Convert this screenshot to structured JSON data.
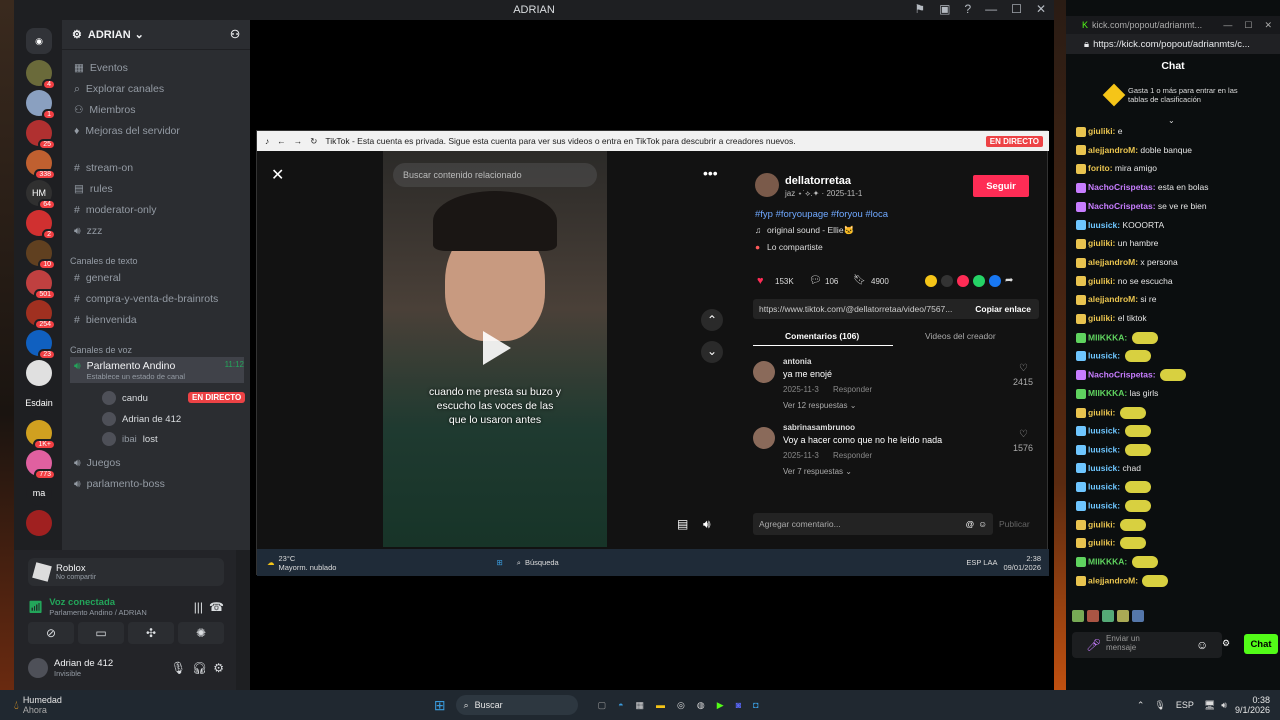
{
  "discord": {
    "title": "ADRIAN",
    "server_name": "ADRIAN",
    "guilds": [
      {
        "badge": "4",
        "label": ""
      },
      {
        "badge": "1",
        "label": ""
      },
      {
        "badge": "25",
        "label": ""
      },
      {
        "badge": "338",
        "label": ""
      },
      {
        "badge": "64",
        "label": "HM"
      },
      {
        "badge": "2",
        "label": ""
      },
      {
        "badge": "10",
        "label": ""
      },
      {
        "badge": "501",
        "label": ""
      },
      {
        "badge": "254",
        "label": ""
      },
      {
        "badge": "23",
        "label": ""
      },
      {
        "badge": "",
        "label": ""
      },
      {
        "badge": "",
        "label": "Esdain"
      },
      {
        "badge": "1K+",
        "label": ""
      },
      {
        "badge": "773",
        "label": ""
      },
      {
        "badge": "",
        "label": "ma"
      },
      {
        "badge": "",
        "label": ""
      }
    ],
    "menu": [
      "Eventos",
      "Explorar canales",
      "Miembros",
      "Mejoras del servidor"
    ],
    "top_channels": [
      "stream-on",
      "rules",
      "moderator-only",
      "zzz"
    ],
    "text_category": "Canales de texto",
    "text_channels": [
      "general",
      "compra-y-venta-de-brainrots",
      "bienvenida"
    ],
    "voice_category": "Canales de voz",
    "voice_channel": {
      "name": "Parlamento Andino",
      "timer": "11:12",
      "status": "Establece un estado de canal"
    },
    "voice_users": [
      {
        "name": "candu",
        "tag": "EN DIRECTO"
      },
      {
        "name": "Adrian de 412",
        "tag": ""
      },
      {
        "name": "ibai",
        "tag": "lost"
      }
    ],
    "other_channels": [
      "Juegos",
      "parlamento-boss"
    ],
    "activity": {
      "title": "Roblox",
      "subtitle": "No compartir"
    },
    "voice_connected": {
      "title": "Voz conectada",
      "subtitle": "Parlamento Andino / ADRIAN"
    },
    "user": {
      "name": "Adrian de 412",
      "status": "Invisible"
    }
  },
  "tiktok": {
    "bar_text": "TikTok - Esta cuenta es privada. Sigue esta cuenta para ver sus videos o entra en TikTok para descubrir a creadores nuevos.",
    "live_label": "EN DIRECTO",
    "search_placeholder": "Buscar contenido relacionado",
    "caption_line1": "cuando me presta su buzo y",
    "caption_line2": "escucho las voces de las",
    "caption_line3": "que lo usaron antes",
    "username": "dellatorretaa",
    "handle_date": "jaz ⋆˙⟡.✦ · 2025-11-1",
    "follow": "Seguir",
    "hashtags": "#fyp #foryoupage #foryou #loca",
    "sound": "original sound - Ellie🐱",
    "shared": "Lo compartiste",
    "likes": "153K",
    "comments_count": "106",
    "saves": "4900",
    "link": "https://www.tiktok.com/@dellatorretaa/video/7567...",
    "copy_link": "Copiar enlace",
    "tab_comments": "Comentarios (106)",
    "tab_videos": "Videos del creador",
    "comments": [
      {
        "user": "antonia",
        "text": "ya me enojé",
        "date": "2025-11-3",
        "reply": "Responder",
        "likes": "2415",
        "replies": "Ver 12 respuestas"
      },
      {
        "user": "sabrinasambrunoo",
        "text": "Voy a hacer como que no he leído nada",
        "date": "2025-11-3",
        "reply": "Responder",
        "likes": "1576",
        "replies": "Ver 7 respuestas"
      }
    ],
    "add_comment": "Agregar comentario...",
    "publish": "Publicar",
    "weather_temp": "23°C",
    "weather_desc": "Mayorm. nublado",
    "inner_search": "Búsqueda",
    "inner_lang": "ESP\nLAA",
    "inner_time": "2:38",
    "inner_date": "09/01/2026"
  },
  "kick": {
    "window_title": "kick.com/popout/adrianmt...",
    "url": "https://kick.com/popout/adrianmts/c...",
    "chat_title": "Chat",
    "promo": "Gasta 1 o más para entrar en las tablas de clasificación",
    "messages": [
      {
        "user": "giuliki",
        "text": "e",
        "color": "#e9c44f"
      },
      {
        "user": "alejjandroM",
        "text": "doble banque",
        "color": "#e9c44f"
      },
      {
        "user": "forito",
        "text": "mira amigo",
        "color": "#e9c44f"
      },
      {
        "user": "NachoCrispetas",
        "text": "esta en bolas",
        "color": "#c77dff"
      },
      {
        "user": "NachoCrispetas",
        "text": "se ve re bien",
        "color": "#c77dff"
      },
      {
        "user": "luusick",
        "text": "KOOORTA",
        "color": "#6ec6ff"
      },
      {
        "user": "giuliki",
        "text": "un hambre",
        "color": "#e9c44f"
      },
      {
        "user": "alejjandroM",
        "text": "x persona",
        "color": "#e9c44f"
      },
      {
        "user": "giuliki",
        "text": "no se escucha",
        "color": "#e9c44f"
      },
      {
        "user": "alejjandroM",
        "text": "si re",
        "color": "#e9c44f"
      },
      {
        "user": "giuliki",
        "text": "el tiktok",
        "color": "#e9c44f"
      },
      {
        "user": "MIIKKKA",
        "text": "",
        "color": "#5fd35f"
      },
      {
        "user": "luusick",
        "text": "",
        "color": "#6ec6ff"
      },
      {
        "user": "NachoCrispetas",
        "text": "",
        "color": "#c77dff"
      },
      {
        "user": "MIIKKKA",
        "text": "las girls",
        "color": "#5fd35f"
      },
      {
        "user": "giuliki",
        "text": "",
        "color": "#e9c44f"
      },
      {
        "user": "luusick",
        "text": "",
        "color": "#6ec6ff"
      },
      {
        "user": "luusick",
        "text": "",
        "color": "#6ec6ff"
      },
      {
        "user": "luusick",
        "text": "chad",
        "color": "#6ec6ff"
      },
      {
        "user": "luusick",
        "text": "",
        "color": "#6ec6ff"
      },
      {
        "user": "luusick",
        "text": "",
        "color": "#6ec6ff"
      },
      {
        "user": "giuliki",
        "text": "",
        "color": "#e9c44f"
      },
      {
        "user": "giuliki",
        "text": "",
        "color": "#e9c44f"
      },
      {
        "user": "MIIKKKA",
        "text": "",
        "color": "#5fd35f"
      },
      {
        "user": "alejjandroM",
        "text": "",
        "color": "#e9c44f"
      }
    ],
    "input_placeholder": "Enviar un mensaje",
    "chat_button": "Chat"
  },
  "taskbar": {
    "weather_title": "Humedad",
    "weather_sub": "Ahora",
    "search": "Buscar",
    "lang": "ESP",
    "time": "0:38",
    "date": "9/1/2026"
  },
  "colors": {
    "accent_kick": "#53fc18",
    "discord_bg": "#1e1f22",
    "tiktok_follow": "#fe2c55",
    "live_red": "#ed4245"
  }
}
